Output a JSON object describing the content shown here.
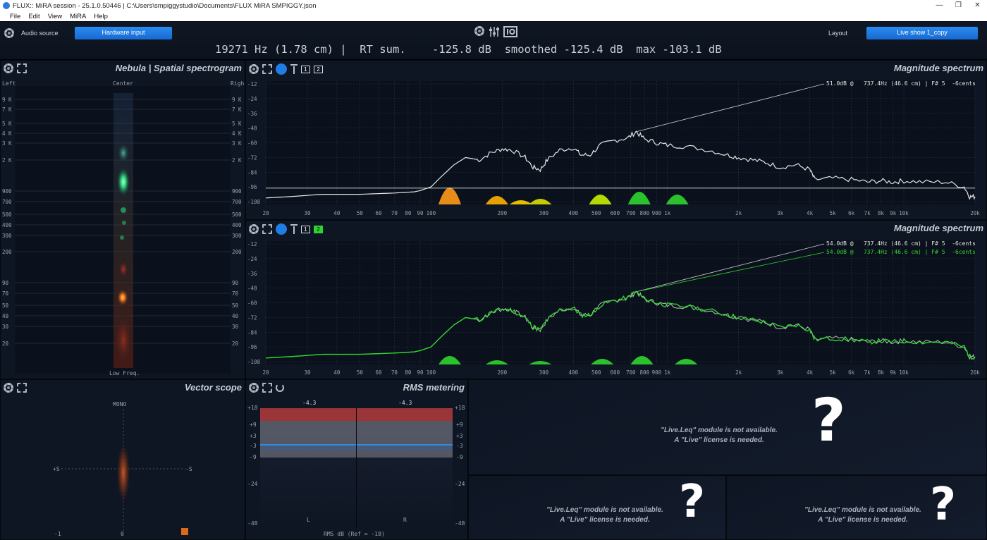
{
  "window": {
    "title": "FLUX:: MiRA session - 25.1.0.50446 | C:\\Users\\smpiggystudio\\Documents\\FLUX MiRA SMPIGGY.json",
    "menu": [
      "File",
      "Edit",
      "View",
      "MiRA",
      "Help"
    ]
  },
  "topbar": {
    "audio_source_label": "Audio source",
    "audio_source_value": "Hardware input",
    "layout_label": "Layout",
    "layout_value": "Live show 1_copy",
    "readout": "19271 Hz (1.78 cm) |  RT sum.    -125.8 dB  smoothed -125.4 dB  max -103.1 dB"
  },
  "nebula": {
    "title": "Nebula | Spatial spectrogram",
    "left": "Left",
    "center": "Center",
    "right": "Right",
    "bottom": "Low Freq.",
    "freq_labels": [
      "9 K",
      "7 K",
      "5 K",
      "4 K",
      "3 K",
      "2 K",
      "900",
      "700",
      "500",
      "400",
      "300",
      "200",
      "90",
      "70",
      "50",
      "40",
      "30",
      "20"
    ]
  },
  "spectrum1": {
    "title": "Magnitude spectrum",
    "marker_text": "51.0dB @   737.4Hz (46.6 cm) | F# 5  -6cents",
    "tabs": [
      "1",
      "2"
    ]
  },
  "spectrum2": {
    "title": "Magnitude spectrum",
    "marker_text_1": "54.0dB @   737.4Hz (46.6 cm) | F# 5  -6cents",
    "marker_text_2": "54.0dB @   737.4Hz (46.6 cm) | F# 5  -6cents",
    "tabs": [
      "1",
      "2"
    ]
  },
  "spectrum_axes": {
    "db_labels": [
      "-12",
      "-24",
      "-36",
      "-48",
      "-60",
      "-72",
      "-84",
      "-96",
      "-108"
    ],
    "freq_labels": [
      "20",
      "30",
      "40",
      "50",
      "60",
      "70",
      "80",
      "90",
      "100",
      "200",
      "300",
      "400",
      "500",
      "600",
      "700",
      "800",
      "900",
      "1k",
      "2k",
      "3k",
      "4k",
      "5k",
      "6k",
      "7k",
      "8k",
      "9k",
      "10k",
      "20k"
    ]
  },
  "vectorscope": {
    "title": "Vector scope",
    "mono": "MONO",
    "plus_s": "+S",
    "minus_s": "-S",
    "minus_one": "-1",
    "zero": "0"
  },
  "rms": {
    "title": "RMS metering",
    "left_value": "-4.3",
    "right_value": "-4.3",
    "scale": [
      "+18",
      "+9",
      "+3",
      "-3",
      "-9",
      "-24",
      "-48"
    ],
    "channel_l": "L",
    "channel_r": "R",
    "footer": "RMS dB (Ref = -18)"
  },
  "unavailable": {
    "line1": "\"Live.Leq\" module is not available.",
    "line2": "A \"Live\" license is needed.",
    "qmark": "?"
  },
  "colors": {
    "accent_blue": "#1f7de6",
    "trace_white": "#e6e6e6",
    "trace_green": "#2fd52f"
  }
}
